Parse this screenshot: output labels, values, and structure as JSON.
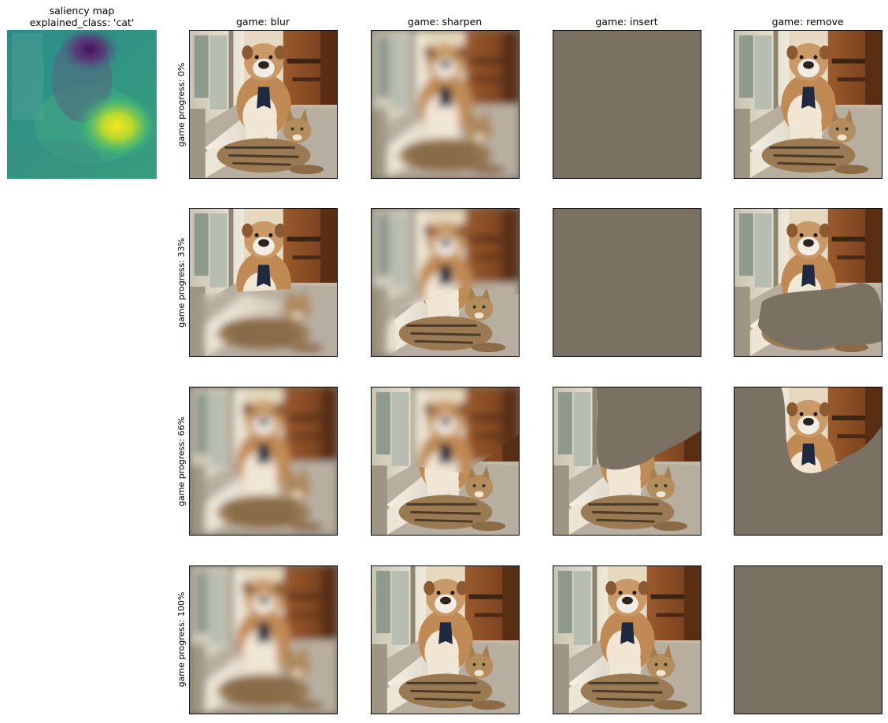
{
  "saliency_title": {
    "line1": "saliency map",
    "line2": "explained_class: 'cat'"
  },
  "columns": [
    {
      "title": "game: blur",
      "mode": "blur"
    },
    {
      "title": "game: sharpen",
      "mode": "sharpen"
    },
    {
      "title": "game: insert",
      "mode": "insert"
    },
    {
      "title": "game: remove",
      "mode": "remove"
    }
  ],
  "rows": [
    {
      "label": "game progress: 0%",
      "progress": 0
    },
    {
      "label": "game progress: 33%",
      "progress": 33
    },
    {
      "label": "game progress: 66%",
      "progress": 66
    },
    {
      "label": "game progress: 100%",
      "progress": 100
    }
  ],
  "colors": {
    "mask_gray": "#7b7163",
    "wall": "#e7ddc8",
    "floor": "#bdb3a4",
    "cabinet": "#8d4c22",
    "dog": "#c8935c",
    "cat": "#9a7d58"
  }
}
